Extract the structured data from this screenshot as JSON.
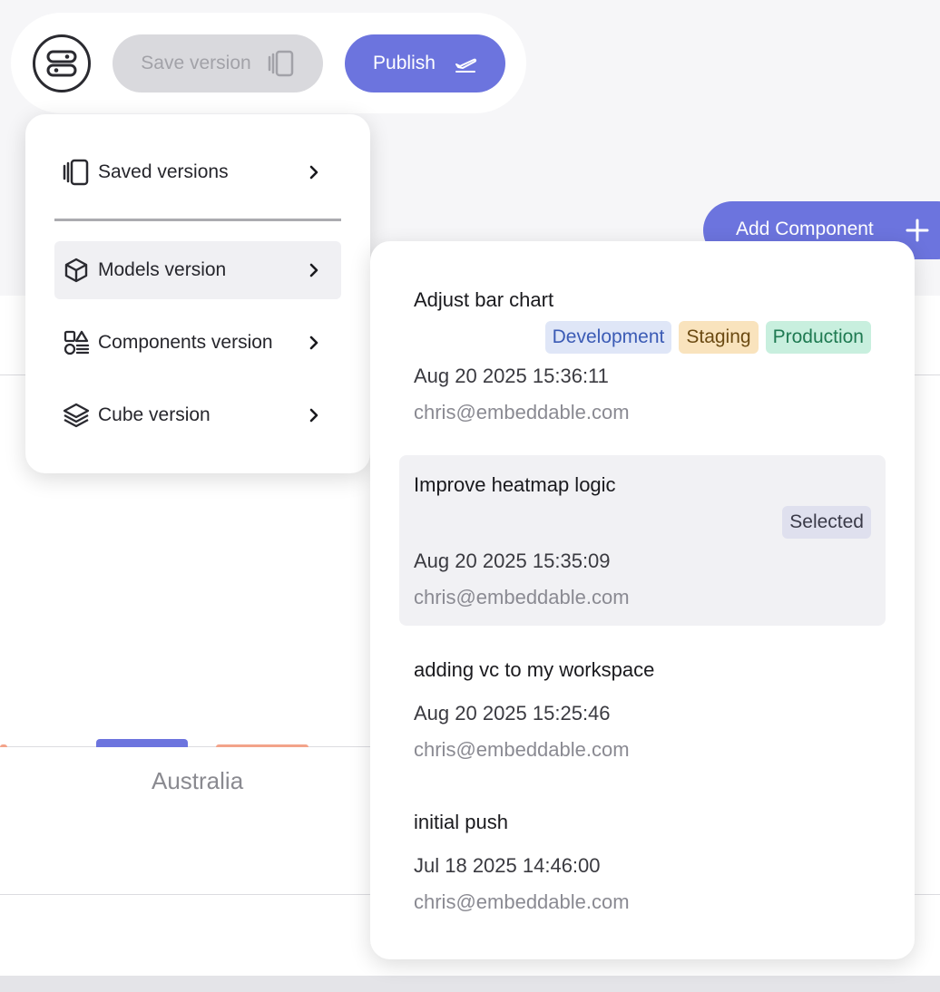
{
  "toolbar": {
    "save_label": "Save version",
    "publish_label": "Publish"
  },
  "add_component_label": "Add Component",
  "menu": {
    "items": [
      {
        "label": "Saved versions",
        "icon": "versions-icon"
      },
      {
        "label": "Models version",
        "icon": "cube-icon"
      },
      {
        "label": "Components version",
        "icon": "components-icon"
      },
      {
        "label": "Cube version",
        "icon": "layers-icon"
      }
    ],
    "active_item": "Models version"
  },
  "versions": [
    {
      "title": "Adjust bar chart",
      "badges": [
        "Development",
        "Staging",
        "Production"
      ],
      "date": "Aug 20 2025 15:36:11",
      "author": "chris@embeddable.com",
      "selected": false
    },
    {
      "title": "Improve heatmap logic",
      "badges": [
        "Selected"
      ],
      "date": "Aug 20 2025 15:35:09",
      "author": "chris@embeddable.com",
      "selected": true
    },
    {
      "title": "adding vc to my workspace",
      "badges": [],
      "date": "Aug 20 2025 15:25:46",
      "author": "chris@embeddable.com",
      "selected": false
    },
    {
      "title": "initial push",
      "badges": [],
      "date": "Jul 18 2025 14:46:00",
      "author": "chris@embeddable.com",
      "selected": false
    }
  ],
  "background_chart": {
    "category_label": "Australia"
  },
  "colors": {
    "accent": "#6c74de",
    "badge_development_bg": "#dfe6f7",
    "badge_development_fg": "#3b5bb5",
    "badge_staging_bg": "#f9e3bd",
    "badge_staging_fg": "#6b4a12",
    "badge_production_bg": "#c8efde",
    "badge_production_fg": "#1f7a52",
    "badge_selected_bg": "#dfe0ee",
    "badge_selected_fg": "#3a3a48",
    "bar_series_1": "#6c74de",
    "bar_series_2": "#f3a38a"
  }
}
